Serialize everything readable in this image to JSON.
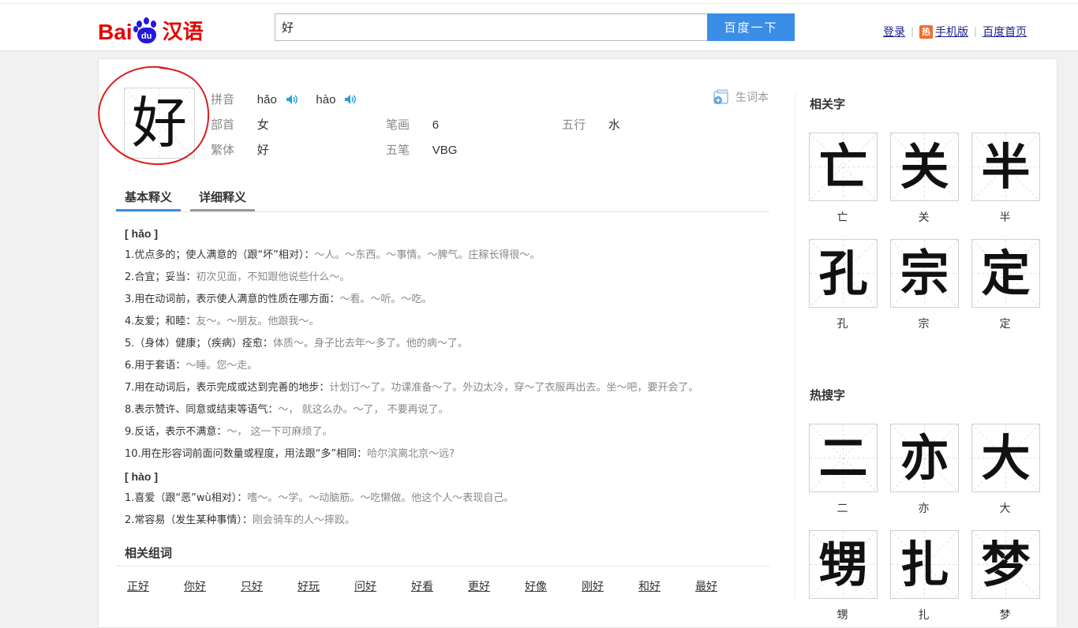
{
  "header": {
    "logo_prefix": "Bai",
    "logo_paw": "du",
    "logo_suffix": "汉语",
    "search_value": "好",
    "search_button": "百度一下",
    "links": {
      "login": "登录",
      "hot_badge": "热",
      "mobile": "手机版",
      "home": "百度首页"
    }
  },
  "entry": {
    "character": "好",
    "labels": {
      "pinyin": "拼音",
      "radical": "部首",
      "traditional": "繁体",
      "strokes": "笔画",
      "wubi": "五笔",
      "wuxing": "五行"
    },
    "pinyin": [
      "hǎo",
      "hào"
    ],
    "radical": "女",
    "traditional": "好",
    "strokes": "6",
    "wubi": "VBG",
    "wuxing": "水",
    "vocab_button": "生词本"
  },
  "tabs": [
    "基本释义",
    "详细释义"
  ],
  "definitions": [
    {
      "type": "py",
      "text": "[ hǎo ]"
    },
    {
      "type": "def",
      "main": "1.优点多的；使人满意的（跟“坏”相对）：",
      "ex": "～人。～东西。～事情。～脾气。庄稼长得很～。"
    },
    {
      "type": "def",
      "main": "2.合宜；妥当：",
      "ex": "初次见面，不知跟他说些什么～。"
    },
    {
      "type": "def",
      "main": "3.用在动词前，表示使人满意的性质在哪方面：",
      "ex": "～看。～听。～吃。"
    },
    {
      "type": "def",
      "main": "4.友爱；和睦：",
      "ex": "友～。～朋友。他跟我～。"
    },
    {
      "type": "def",
      "main": "5.（身体）健康；（疾病）痊愈：",
      "ex": "体质～。身子比去年～多了。他的病～了。"
    },
    {
      "type": "def",
      "main": "6.用于套语：",
      "ex": "～睡。您～走。"
    },
    {
      "type": "def",
      "main": "7.用在动词后，表示完成或达到完善的地步：",
      "ex": "计划订～了。功课准备～了。外边太冷，穿～了衣服再出去。坐～吧，要开会了。"
    },
    {
      "type": "def",
      "main": "8.表示赞许、同意或结束等语气：",
      "ex": "～， 就这么办。～了， 不要再说了。"
    },
    {
      "type": "def",
      "main": "9.反话，表示不满意：",
      "ex": "～， 这一下可麻烦了。"
    },
    {
      "type": "def",
      "main": "10.用在形容词前面问数量或程度，用法跟“多”相同：",
      "ex": "哈尔滨离北京～远?"
    },
    {
      "type": "py",
      "text": "[ hào ]"
    },
    {
      "type": "def",
      "main": "1.喜爱（跟“恶”wù相对）：",
      "ex": "嗜～。～学。～动脑筋。～吃懒做。他这个人～表现自己。"
    },
    {
      "type": "def",
      "main": "2.常容易（发生某种事情）：",
      "ex": "刚会骑车的人～摔跤。"
    }
  ],
  "related_words": {
    "heading": "相关组词",
    "items": [
      "正好",
      "你好",
      "只好",
      "好玩",
      "问好",
      "好看",
      "更好",
      "好像",
      "刚好",
      "和好",
      "最好"
    ]
  },
  "sidebar": {
    "related_heading": "相关字",
    "related_chars": [
      "亡",
      "关",
      "半",
      "孔",
      "宗",
      "定"
    ],
    "hot_heading": "热搜字",
    "hot_chars": [
      "二",
      "亦",
      "大",
      "甥",
      "扎",
      "梦"
    ]
  }
}
